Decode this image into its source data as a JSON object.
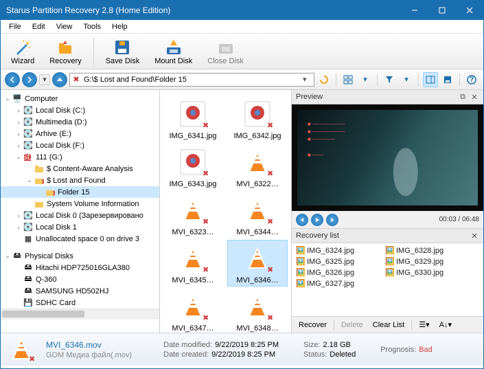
{
  "window": {
    "title": "Starus Partition Recovery 2.8 (Home Edition)"
  },
  "menu": {
    "file": "File",
    "edit": "Edit",
    "view": "View",
    "tools": "Tools",
    "help": "Help"
  },
  "toolbar": {
    "wizard": "Wizard",
    "recovery": "Recovery",
    "save_disk": "Save Disk",
    "mount_disk": "Mount Disk",
    "close_disk": "Close Disk"
  },
  "address": {
    "path": "G:\\$ Lost and Found\\Folder 15"
  },
  "tree": {
    "computer": "Computer",
    "local_c": "Local Disk (C:)",
    "multimedia": "Multimedia (D:)",
    "arhive": "Arhive (E:)",
    "local_f": "Local Disk (F:)",
    "drive_g": "111 (G:)",
    "content_aware": "$ Content-Aware Analysis",
    "lost_found": "$ Lost and Found",
    "folder15": "Folder 15",
    "sys_vol": "System Volume Information",
    "local_0": "Local Disk 0 (Зарезервировано",
    "local_1": "Local Disk 1",
    "unalloc": "Unallocated space 0 on drive 3",
    "physical": "Physical Disks",
    "hitachi": "Hitachi HDP725016GLA380",
    "q360": "Q-360",
    "samsung": "SAMSUNG HD502HJ",
    "sdhc": "SDHC Card"
  },
  "thumbs": {
    "i1": "IMG_6341.jpg",
    "i2": "IMG_6342.jpg",
    "i3": "IMG_6343.jpg",
    "i4": "MVI_6322…",
    "i5": "MVI_6323…",
    "i6": "MVI_6344…",
    "i7": "MVI_6345…",
    "i8": "MVI_6346…",
    "i9": "MVI_6347…",
    "i10": "MVI_6348…"
  },
  "preview": {
    "title": "Preview",
    "time": "00:03 / 06:48"
  },
  "recovery_list": {
    "title": "Recovery list",
    "items": {
      "r1": "IMG_6324.jpg",
      "r2": "IMG_6328.jpg",
      "r3": "IMG_6325.jpg",
      "r4": "IMG_6329.jpg",
      "r5": "IMG_6326.jpg",
      "r6": "IMG_6330.jpg",
      "r7": "IMG_6327.jpg"
    },
    "recover": "Recover",
    "delete": "Delete",
    "clear": "Clear List"
  },
  "status": {
    "name": "MVI_6346.mov",
    "type": "GOM Медиа файл(.mov)",
    "date_modified_k": "Date modified:",
    "date_modified_v": "9/22/2019 8:25 PM",
    "date_created_k": "Date created:",
    "date_created_v": "9/22/2019 8:25 PM",
    "size_k": "Size:",
    "size_v": "2.18 GB",
    "status_k": "Status:",
    "status_v": "Deleted",
    "prognosis_k": "Prognosis:",
    "prognosis_v": "Bad"
  }
}
